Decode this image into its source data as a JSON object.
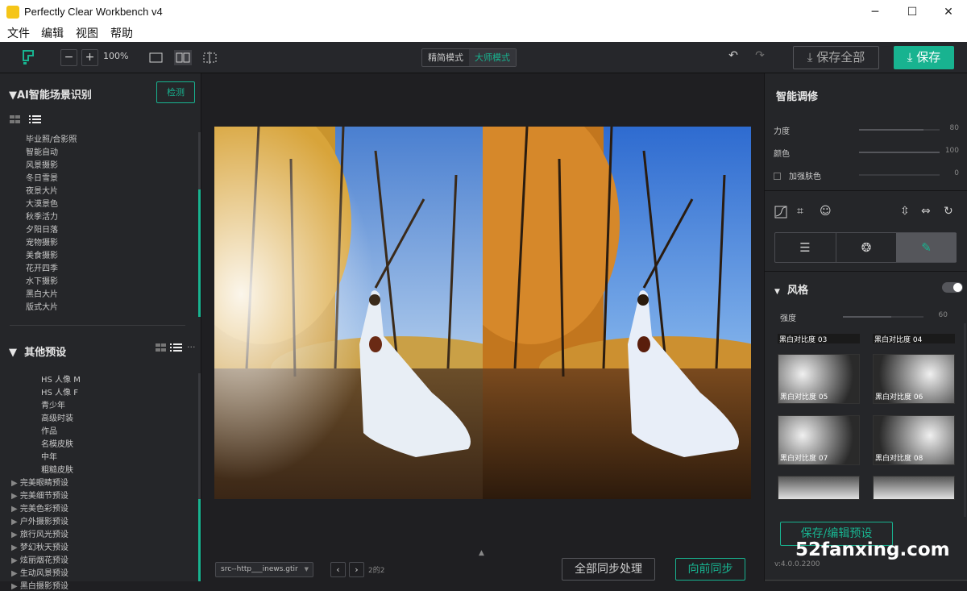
{
  "window": {
    "title": "Perfectly Clear Workbench v4",
    "controls": {
      "minimize": "─",
      "maximize": "☐",
      "close": "✕"
    }
  },
  "menu": [
    "文件",
    "编辑",
    "视图",
    "帮助"
  ],
  "toolbar": {
    "zoom_out": "−",
    "zoom_in": "+",
    "zoom_level": "100%",
    "modes": [
      "精简模式",
      "大师模式"
    ],
    "active_mode": "大师模式",
    "undo": "↶",
    "redo": "↷",
    "save_all_label": "保存全部",
    "save_label": "保存"
  },
  "left": {
    "ai_title": "AI智能场景识别",
    "detect_label": "检测",
    "ai_items": [
      "毕业照/合影照",
      "智能自动",
      "风景摄影",
      "冬日雪景",
      "夜景大片",
      "大漠景色",
      "秋季活力",
      "夕阳日落",
      "宠物摄影",
      "美食摄影",
      "花开四季",
      "水下摄影",
      "黑白大片",
      "版式大片"
    ],
    "other_title": "其他预设",
    "other_items": [
      "HS 人像 M",
      "HS 人像 F",
      "青少年",
      "高级时装",
      "作品",
      "名模皮肤",
      "中年",
      "粗糙皮肤"
    ],
    "groups": [
      "完美眼睛预设",
      "完美细节预设",
      "完美色彩预设",
      "户外摄影预设",
      "旅行风光预设",
      "梦幻秋天预设",
      "炫丽烟花预设",
      "生动风景预设",
      "黑白摄影预设"
    ]
  },
  "center": {
    "file_select": "src--http___inews.gtir",
    "page_info": "2的2",
    "sync_all_label": "全部同步处理",
    "sync_forward_label": "向前同步",
    "collapse_arrow": "▲"
  },
  "right": {
    "smart_title": "智能调修",
    "sliders": [
      {
        "label": "力度",
        "value": "80",
        "fraction": 0.8
      },
      {
        "label": "颜色",
        "value": "100",
        "fraction": 1.0
      },
      {
        "label": "加强肤色",
        "value": "0",
        "fraction": 0.0
      }
    ],
    "style_title": "风格",
    "strength_label": "强度",
    "strength_value": "60",
    "strength_fraction": 0.6,
    "thumbs_top": [
      "黑白对比度 03",
      "黑白对比度 04"
    ],
    "thumbs": [
      "黑白对比度 05",
      "黑白对比度 06",
      "黑白对比度 07",
      "黑白对比度 08"
    ],
    "save_preset_label": "保存/编辑预设",
    "version": "v:4.0.0.2200"
  },
  "watermark": "52fanxing.com",
  "colors": {
    "accent": "#18b390",
    "bg": "#252629"
  }
}
